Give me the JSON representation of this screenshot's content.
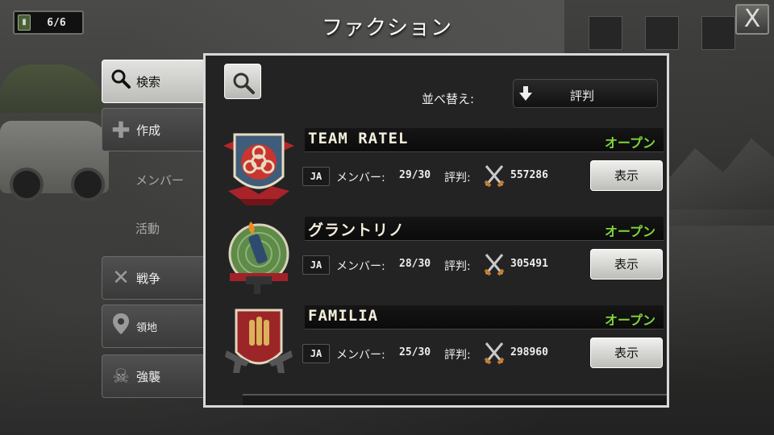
{
  "header": {
    "title": "ファクション",
    "close_label": "X"
  },
  "resource": {
    "icon": "battery-icon",
    "value": "6/6"
  },
  "sidebar": {
    "items": [
      {
        "label": "検索",
        "icon": "search-icon"
      },
      {
        "label": "作成",
        "icon": "plus-icon"
      },
      {
        "label": "メンバー",
        "icon": ""
      },
      {
        "label": "活動",
        "icon": ""
      },
      {
        "label": "戦争",
        "icon": "crossed-swords-icon"
      },
      {
        "label": "領地",
        "icon": "map-pin-icon"
      },
      {
        "label": "強襲",
        "icon": "skull-icon"
      }
    ]
  },
  "sort": {
    "label": "並べ替え:",
    "value": "評判",
    "icon": "down-arrow-icon"
  },
  "list": {
    "members_label": "メンバー:",
    "reputation_label": "評判:",
    "view_label": "表示",
    "factions": [
      {
        "name": "TEAM RATEL",
        "status": "オープン",
        "lang": "JA",
        "members": "29/30",
        "reputation": "557286",
        "emblem": "biohazard-shield-emblem"
      },
      {
        "name": "グラントリノ",
        "status": "オープン",
        "lang": "JA",
        "members": "28/30",
        "reputation": "305491",
        "emblem": "molotov-target-emblem"
      },
      {
        "name": "FAMILIA",
        "status": "オープン",
        "lang": "JA",
        "members": "25/30",
        "reputation": "298960",
        "emblem": "bullets-pistols-emblem"
      }
    ]
  },
  "colors": {
    "status_open": "#7ed63b",
    "panel_border": "#d8d8d8",
    "panel_bg": "#232323"
  }
}
